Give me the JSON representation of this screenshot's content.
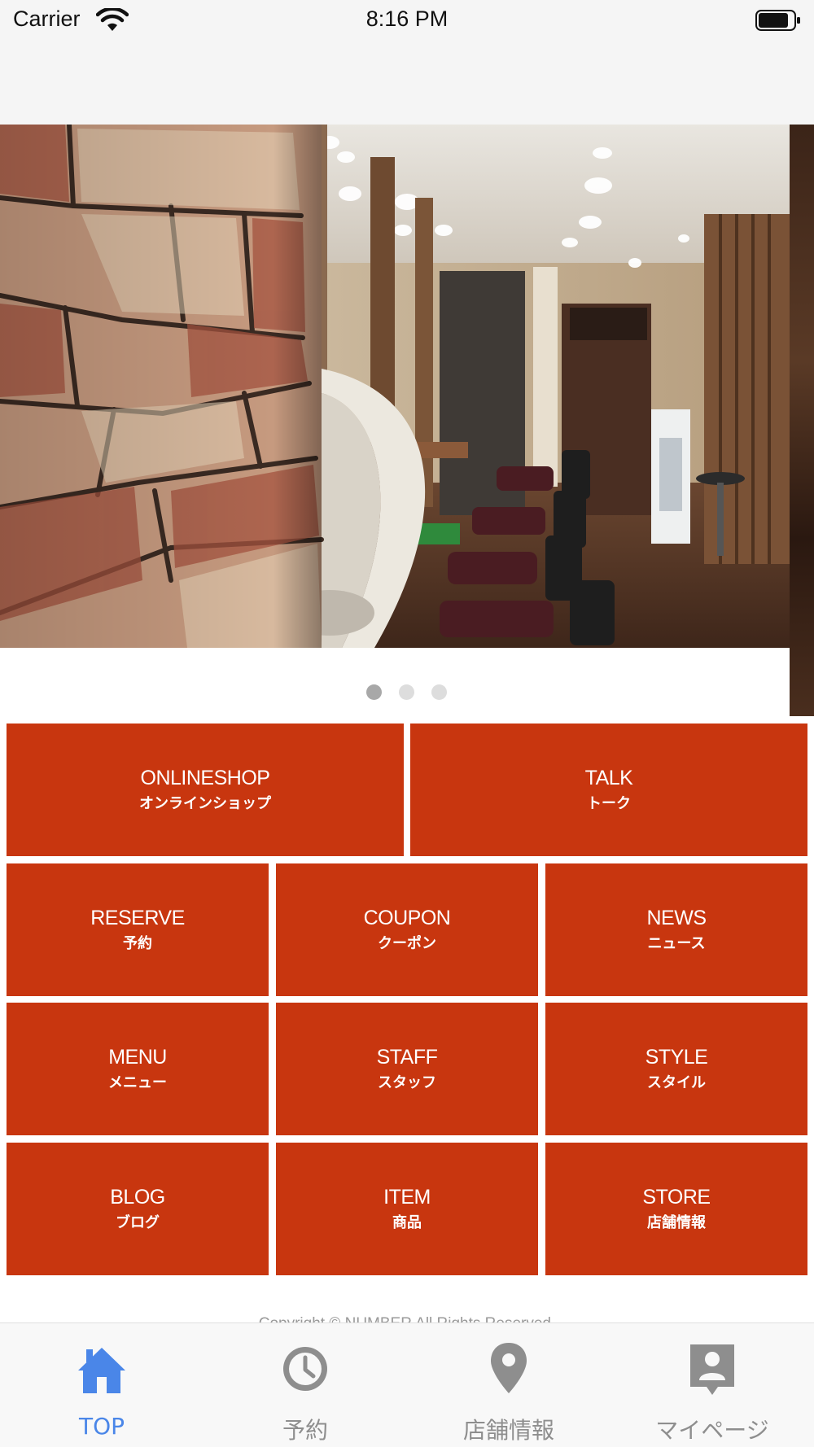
{
  "status_bar": {
    "carrier": "Carrier",
    "time": "8:16 PM"
  },
  "carousel": {
    "page_count": 3,
    "active_index": 0
  },
  "menu": {
    "row1": [
      {
        "en": "ONLINESHOP",
        "ja": "オンラインショップ"
      },
      {
        "en": "TALK",
        "ja": "トーク"
      }
    ],
    "row2": [
      {
        "en": "RESERVE",
        "ja": "予約"
      },
      {
        "en": "COUPON",
        "ja": "クーポン"
      },
      {
        "en": "NEWS",
        "ja": "ニュース"
      }
    ],
    "row3": [
      {
        "en": "MENU",
        "ja": "メニュー"
      },
      {
        "en": "STAFF",
        "ja": "スタッフ"
      },
      {
        "en": "STYLE",
        "ja": "スタイル"
      }
    ],
    "row4": [
      {
        "en": "BLOG",
        "ja": "ブログ"
      },
      {
        "en": "ITEM",
        "ja": "商品"
      },
      {
        "en": "STORE",
        "ja": "店舗情報"
      }
    ]
  },
  "footer": {
    "copyright": "Copyright © NUMBER All Rights Reserved."
  },
  "tab_bar": {
    "tabs": [
      {
        "label": "TOP",
        "icon": "home-icon",
        "active": true
      },
      {
        "label": "予約",
        "icon": "clock-icon",
        "active": false
      },
      {
        "label": "店舗情報",
        "icon": "map-pin-icon",
        "active": false
      },
      {
        "label": "マイページ",
        "icon": "profile-badge-icon",
        "active": false
      }
    ]
  },
  "colors": {
    "tile": "#c8360f",
    "tab_active": "#4a86e8",
    "tab_inactive": "#8e8e8e",
    "dot_active": "#a8a8a8",
    "dot_inactive": "#dddddd"
  }
}
